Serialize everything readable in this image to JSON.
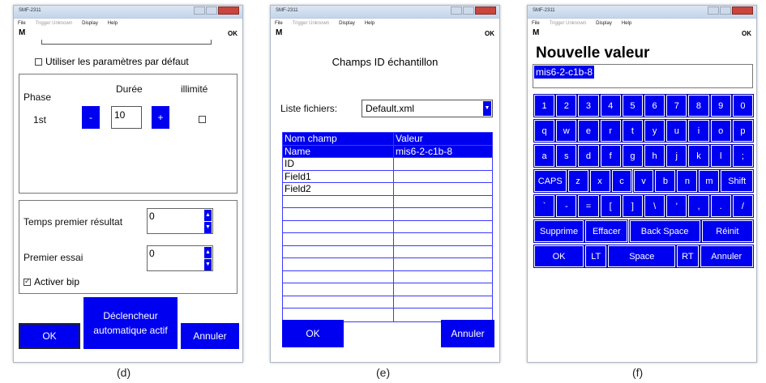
{
  "window": {
    "title": "SMF-2311",
    "menu": [
      "File",
      "Trigger Unknown",
      "Display",
      "Help"
    ]
  },
  "toolbar": {
    "left_icon": "M",
    "right_icon": "OK"
  },
  "panel_d": {
    "caption": "(d)",
    "default_params": "Utiliser les paramètres par défaut",
    "phase_label": "Phase",
    "duration_label": "Durée",
    "unlimited_label": "illimité",
    "phase_value": "1st",
    "minus": "-",
    "duration_value": "10",
    "plus": "+",
    "first_result_label": "Temps premier résultat",
    "first_result_value": "0",
    "first_try_label": "Premier essai",
    "first_try_value": "0",
    "beep_label": "Activer bip",
    "ok": "OK",
    "auto_trigger": "Déclencheur automatique actif",
    "cancel": "Annuler"
  },
  "panel_e": {
    "caption": "(e)",
    "title": "Champs ID échantillon",
    "file_list_label": "Liste fichiers:",
    "file_list_value": "Default.xml",
    "col_name": "Nom champ",
    "col_value": "Valeur",
    "rows": [
      {
        "name": "Name",
        "value": "mis6-2-c1b-8"
      },
      {
        "name": "ID",
        "value": ""
      },
      {
        "name": "Field1",
        "value": ""
      },
      {
        "name": "Field2",
        "value": ""
      },
      {
        "name": "",
        "value": ""
      },
      {
        "name": "",
        "value": ""
      },
      {
        "name": "",
        "value": ""
      },
      {
        "name": "",
        "value": ""
      },
      {
        "name": "",
        "value": ""
      },
      {
        "name": "",
        "value": ""
      },
      {
        "name": "",
        "value": ""
      },
      {
        "name": "",
        "value": ""
      },
      {
        "name": "",
        "value": ""
      },
      {
        "name": "",
        "value": ""
      }
    ],
    "ok": "OK",
    "cancel": "Annuler"
  },
  "panel_f": {
    "caption": "(f)",
    "title": "Nouvelle valeur",
    "input_value": "mis6-2-c1b-8",
    "rows": [
      [
        "1",
        "2",
        "3",
        "4",
        "5",
        "6",
        "7",
        "8",
        "9",
        "0"
      ],
      [
        "q",
        "w",
        "e",
        "r",
        "t",
        "y",
        "u",
        "i",
        "o",
        "p"
      ],
      [
        "a",
        "s",
        "d",
        "f",
        "g",
        "h",
        "j",
        "k",
        "l",
        ";"
      ],
      [
        "CAPS",
        "z",
        "x",
        "c",
        "v",
        "b",
        "n",
        "m",
        "Shift"
      ],
      [
        "`",
        "-",
        "=",
        "[",
        "]",
        "\\",
        "'",
        ",",
        ".",
        "/"
      ],
      [
        "Supprime",
        "Effacer",
        "Back Space",
        "Réinit"
      ],
      [
        "OK",
        "LT",
        "Space",
        "RT",
        "Annuler"
      ]
    ]
  }
}
